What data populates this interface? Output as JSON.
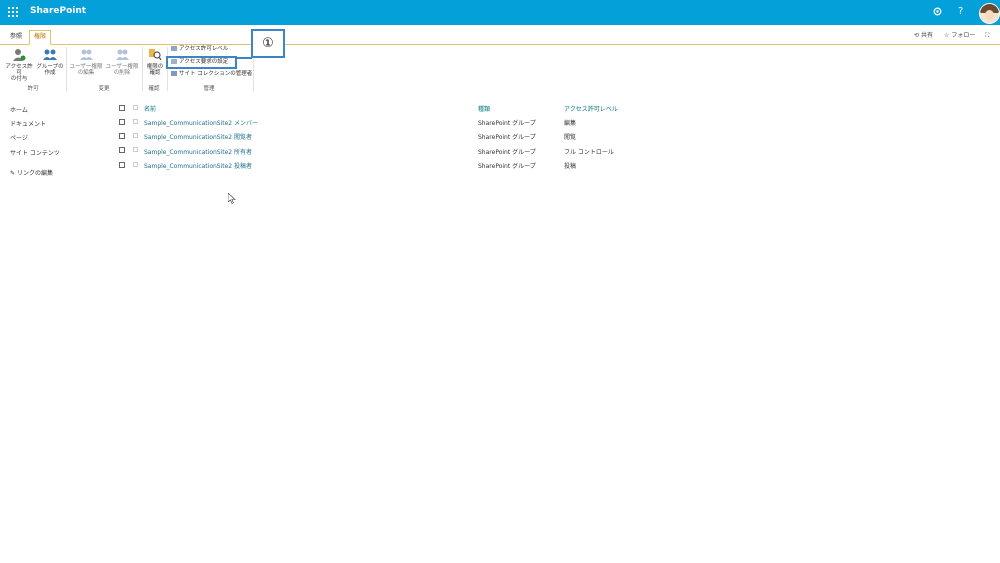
{
  "suite": {
    "brand": "SharePoint",
    "settings_icon": "gear-icon",
    "help_label": "?",
    "avatar_icon": "user-avatar"
  },
  "ribbon_tabs": [
    {
      "label": "参照",
      "active": false
    },
    {
      "label": "権限",
      "active": true
    }
  ],
  "top_right": {
    "share": "共有",
    "follow": "フォロー"
  },
  "ribbon": {
    "grant": {
      "label1": "アクセス許可",
      "label2": "の付与"
    },
    "create_group": {
      "label1": "グループの",
      "label2": "作成"
    },
    "edit_user": {
      "label1": "ユーザー権限",
      "label2": "の編集"
    },
    "remove_user": {
      "label1": "ユーザー権限",
      "label2": "の削除"
    },
    "check": {
      "label1": "権限の",
      "label2": "確認"
    },
    "small": [
      "アクセス許可レベル",
      "アクセス要求の設定",
      "サイト コレクションの管理者"
    ],
    "groups": [
      "許可",
      "変更",
      "確認",
      "管理"
    ]
  },
  "callout": {
    "text": "①"
  },
  "nav": [
    "ホーム",
    "ドキュメント",
    "ページ",
    "サイト コンテンツ",
    "リンクの編集"
  ],
  "table": {
    "headers": [
      "名前",
      "種類",
      "アクセス許可レベル"
    ],
    "rows": [
      {
        "name": "Sample_CommunicationSite2 メンバー",
        "type": "SharePoint グループ",
        "level": "編集"
      },
      {
        "name": "Sample_CommunicationSite2 閲覧者",
        "type": "SharePoint グループ",
        "level": "閲覧"
      },
      {
        "name": "Sample_CommunicationSite2 所有者",
        "type": "SharePoint グループ",
        "level": "フル コントロール"
      },
      {
        "name": "Sample_CommunicationSite2 投稿者",
        "type": "SharePoint グループ",
        "level": "投稿"
      }
    ]
  },
  "colors": {
    "suitebar": "#03a0da",
    "accent": "#e1c16a",
    "link": "#03787c",
    "highlight": "#3d84c6"
  }
}
